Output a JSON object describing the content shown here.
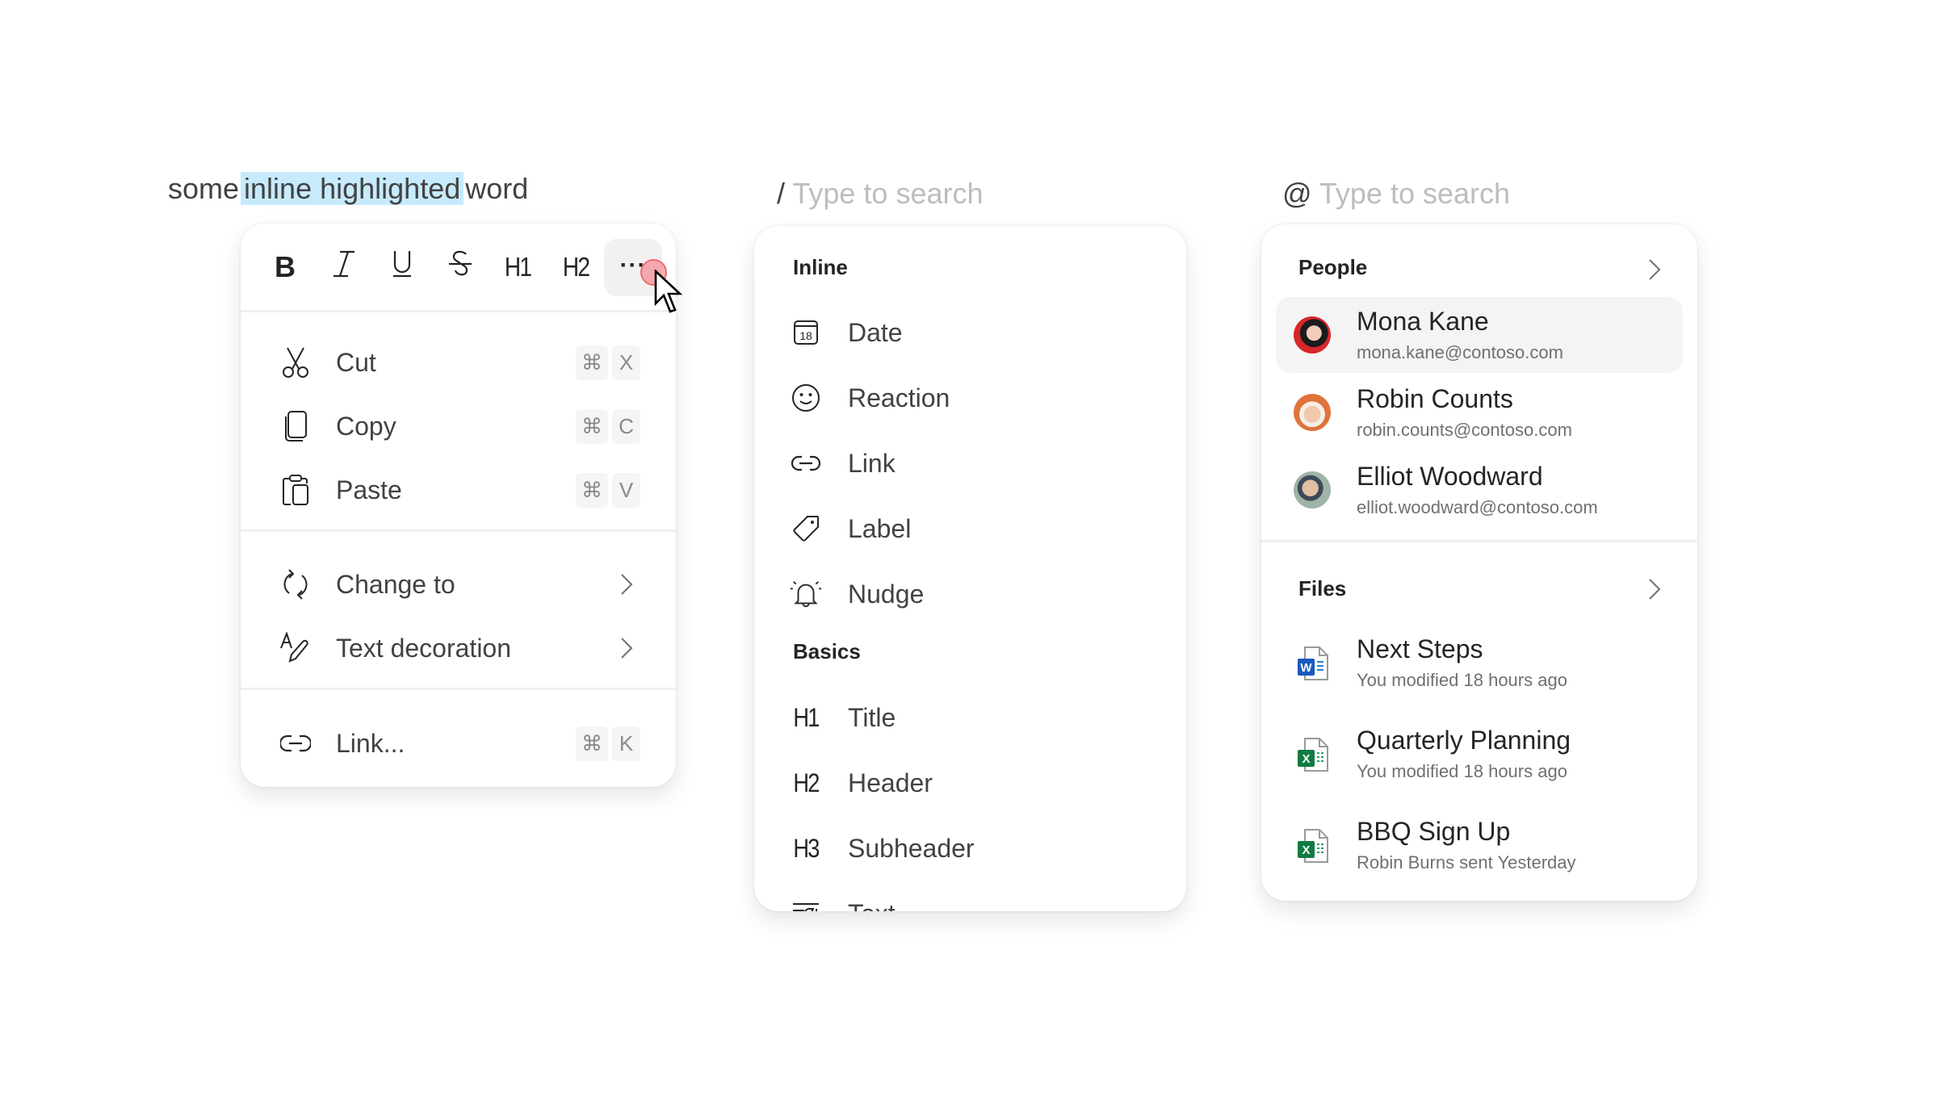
{
  "editor": {
    "text_before": "some",
    "text_highlighted": "inline highlighted",
    "text_after": "word",
    "highlight_color": "#c7ebfd"
  },
  "format_menu": {
    "toolbar": [
      {
        "name": "bold",
        "label": "B",
        "icon": "bold-icon"
      },
      {
        "name": "italic",
        "label": "I",
        "icon": "italic-icon"
      },
      {
        "name": "underline",
        "label": "U",
        "icon": "underline-icon"
      },
      {
        "name": "strikethrough",
        "label": "S",
        "icon": "strikethrough-icon"
      },
      {
        "name": "heading-1",
        "label": "H1",
        "icon": "heading-1-icon"
      },
      {
        "name": "heading-2",
        "label": "H2",
        "icon": "heading-2-icon"
      },
      {
        "name": "more",
        "label": "···",
        "icon": "more-horizontal-icon",
        "active": true
      }
    ],
    "clipboard_items": [
      {
        "label": "Cut",
        "icon": "scissors-icon",
        "shortcut": [
          "⌘",
          "X"
        ]
      },
      {
        "label": "Copy",
        "icon": "copy-icon",
        "shortcut": [
          "⌘",
          "C"
        ]
      },
      {
        "label": "Paste",
        "icon": "clipboard-paste-icon",
        "shortcut": [
          "⌘",
          "V"
        ]
      }
    ],
    "submenu_items": [
      {
        "label": "Change to",
        "icon": "arrow-sync-icon",
        "has_submenu": true
      },
      {
        "label": "Text decoration",
        "icon": "text-edit-style-icon",
        "has_submenu": true
      }
    ],
    "link_item": {
      "label": "Link...",
      "icon": "link-icon",
      "shortcut": [
        "⌘",
        "K"
      ]
    }
  },
  "slash_menu": {
    "trigger": "/",
    "placeholder": "Type to search",
    "sections": [
      {
        "title": "Inline",
        "items": [
          {
            "label": "Date",
            "icon": "calendar-icon",
            "icon_text": "18"
          },
          {
            "label": "Reaction",
            "icon": "emoji-icon"
          },
          {
            "label": "Link",
            "icon": "link-icon"
          },
          {
            "label": "Label",
            "icon": "tag-icon"
          },
          {
            "label": "Nudge",
            "icon": "alert-bell-icon"
          }
        ]
      },
      {
        "title": "Basics",
        "items": [
          {
            "label": "Title",
            "icon": "heading-1-icon",
            "icon_text": "H1"
          },
          {
            "label": "Header",
            "icon": "heading-2-icon",
            "icon_text": "H2"
          },
          {
            "label": "Subheader",
            "icon": "heading-3-icon",
            "icon_text": "H3"
          },
          {
            "label": "Text",
            "icon": "text-paragraph-icon"
          }
        ]
      }
    ]
  },
  "mention_menu": {
    "trigger": "@",
    "placeholder": "Type to search",
    "people_title": "People",
    "people": [
      {
        "name": "Mona Kane",
        "email": "mona.kane@contoso.com",
        "selected": true,
        "avatar_color": "#d8262a"
      },
      {
        "name": "Robin Counts",
        "email": "robin.counts@contoso.com",
        "selected": false,
        "avatar_color": "#e88a4a"
      },
      {
        "name": "Elliot Woodward",
        "email": "elliot.woodward@contoso.com",
        "selected": false,
        "avatar_color": "#7a9a8a"
      }
    ],
    "files_title": "Files",
    "files": [
      {
        "name": "Next Steps",
        "detail": "You modified 18 hours ago",
        "type": "word",
        "badge": "W",
        "color": "#185abd"
      },
      {
        "name": "Quarterly Planning",
        "detail": "You modified 18 hours ago",
        "type": "excel",
        "badge": "X",
        "color": "#107c41"
      },
      {
        "name": "BBQ Sign Up",
        "detail": "Robin Burns sent Yesterday",
        "type": "excel",
        "badge": "X",
        "color": "#107c41"
      }
    ]
  }
}
